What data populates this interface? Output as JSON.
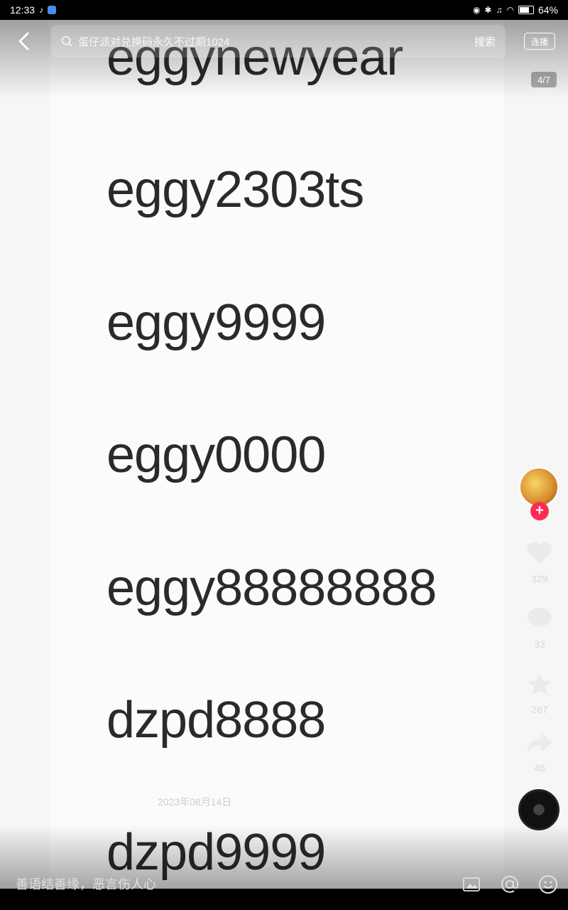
{
  "status_bar": {
    "time": "12:33",
    "battery": "64%"
  },
  "search": {
    "placeholder": "蛋仔派对兑换码永久不过期1024",
    "button": "搜索"
  },
  "continuous_play_label": "连播",
  "page_indicator": "4/7",
  "codes": [
    "eggynewyear",
    "eggy2303ts",
    "eggy9999",
    "eggy0000",
    "eggy88888888",
    "dzpd8888",
    "dzpd9999"
  ],
  "side": {
    "likes": "329",
    "comments": "33",
    "favorites": "287",
    "shares": "46"
  },
  "date": "2023年08月14日",
  "comment": {
    "placeholder": "善语结善缘，恶言伤人心"
  },
  "colors": {
    "accent": "#fe2c55"
  },
  "icons": [
    "back-arrow-icon",
    "search-icon",
    "heart-icon",
    "comment-icon",
    "star-icon",
    "share-icon",
    "image-icon",
    "at-icon",
    "emoji-icon"
  ]
}
